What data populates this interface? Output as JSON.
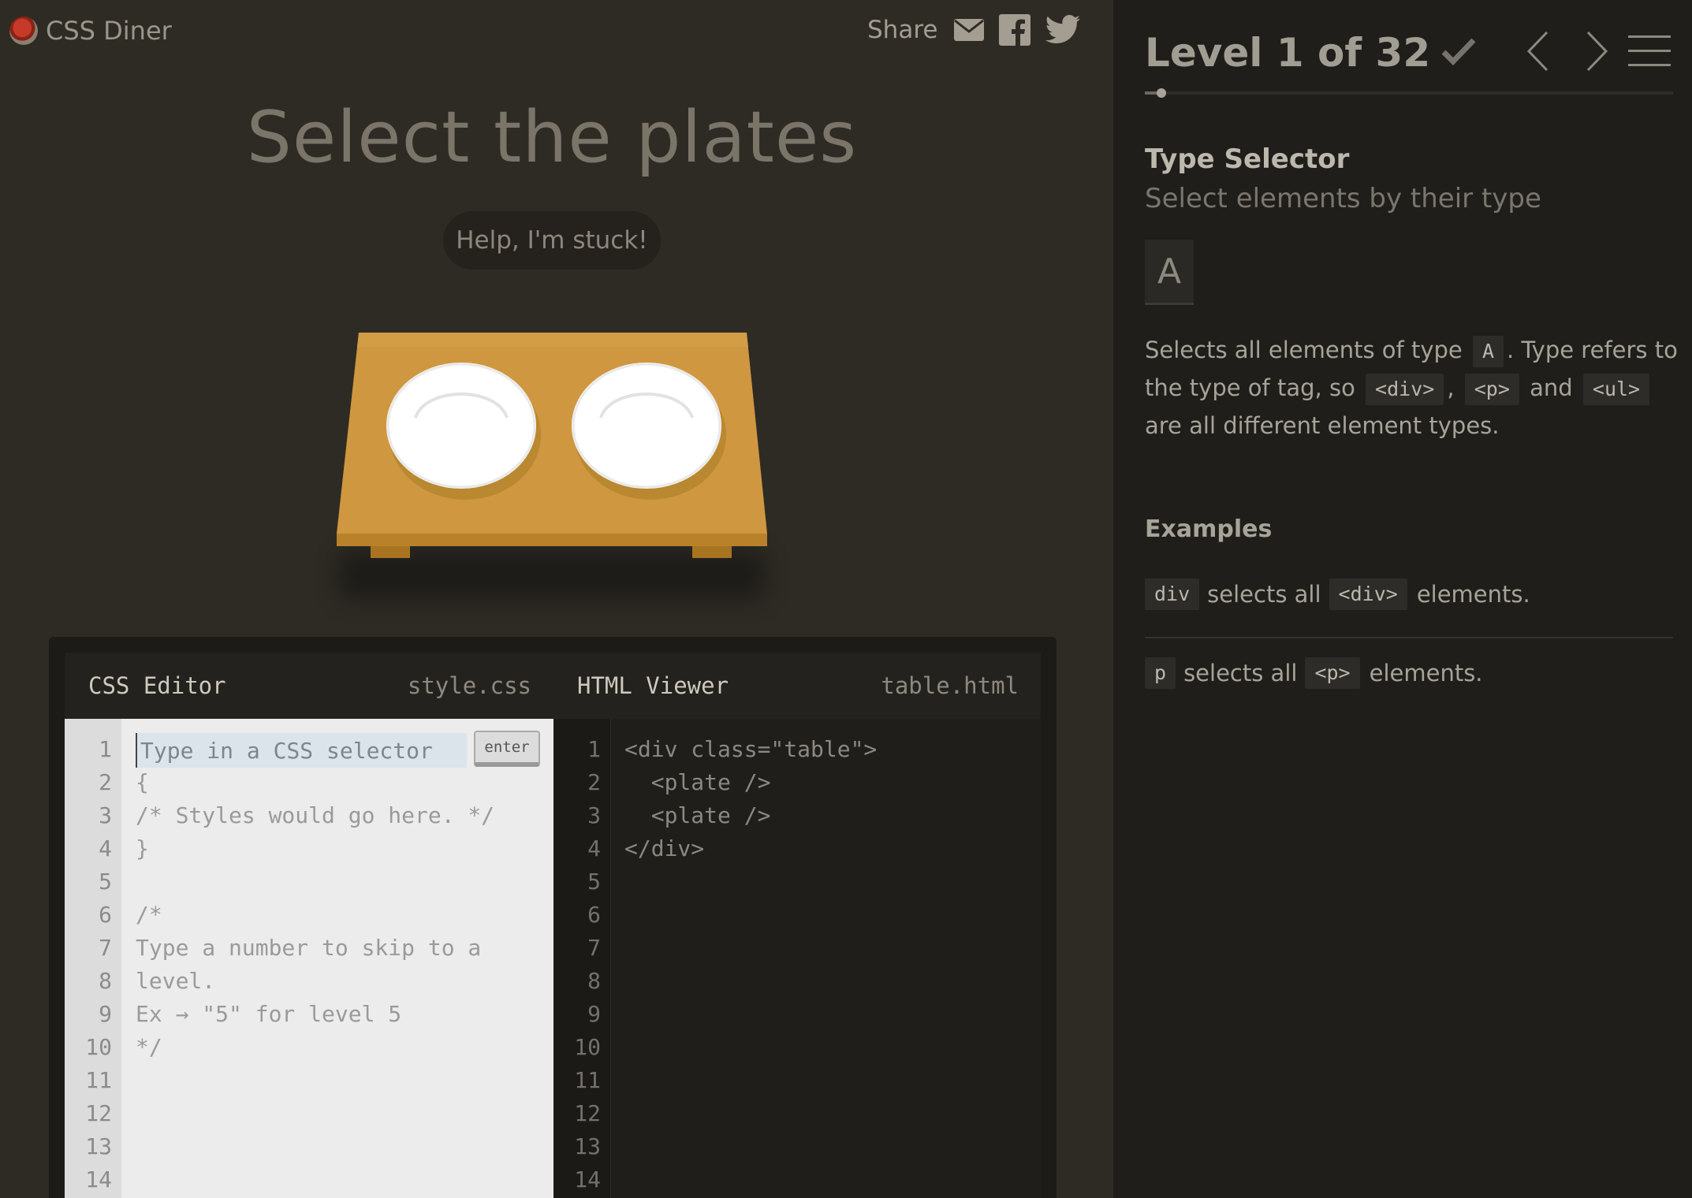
{
  "app": {
    "name": "CSS Diner"
  },
  "share": {
    "label": "Share",
    "icons": [
      "email-icon",
      "facebook-icon",
      "twitter-icon"
    ]
  },
  "game": {
    "instruction": "Select the plates",
    "help_button": "Help, I'm stuck!",
    "table_items": [
      "plate",
      "plate"
    ]
  },
  "css_editor": {
    "title": "CSS Editor",
    "filename": "style.css",
    "input_placeholder": "Type in a CSS selector",
    "enter_label": "enter",
    "line_numbers": [
      "1",
      "2",
      "3",
      "4",
      "5",
      "6",
      "7",
      "8",
      "9",
      "10",
      "11",
      "12",
      "13",
      "14"
    ],
    "lines": [
      "",
      "{",
      "/* Styles would go here. */",
      "}",
      "",
      "/*",
      "Type a number to skip to a",
      "level.",
      "Ex → \"5\" for level 5",
      "*/",
      "",
      "",
      "",
      ""
    ]
  },
  "html_viewer": {
    "title": "HTML Viewer",
    "filename": "table.html",
    "line_numbers": [
      "1",
      "2",
      "3",
      "4",
      "5",
      "6",
      "7",
      "8",
      "9",
      "10",
      "11",
      "12",
      "13",
      "14"
    ],
    "lines": [
      "<div class=\"table\">",
      "  <plate />",
      "  <plate />",
      "</div>",
      "",
      "",
      "",
      "",
      "",
      "",
      "",
      "",
      "",
      ""
    ]
  },
  "sidebar": {
    "level_text": "Level 1 of 32",
    "level_current": 1,
    "level_total": 32,
    "progress_fraction": 0.03125,
    "selector_name": "Type Selector",
    "selector_description": "Select elements by their type",
    "syntax": "A",
    "description": {
      "p1": "Selects all elements of type",
      "t1": "A",
      "p2": ". Type refers to the type of tag, so",
      "t2": "<div>",
      "p3": ",",
      "t3": "<p>",
      "p4": "and",
      "t4": "<ul>",
      "p5": "are all different element types."
    },
    "examples_title": "Examples",
    "examples": [
      {
        "code": "div",
        "text": "selects all",
        "tag": "<div>",
        "suffix": "elements."
      },
      {
        "code": "p",
        "text": "selects all",
        "tag": "<p>",
        "suffix": "elements."
      }
    ]
  },
  "colors": {
    "background": "#2e2b25",
    "sidebar": "#1f1e1b",
    "table": "#cf9740",
    "plate": "#ffffff"
  }
}
